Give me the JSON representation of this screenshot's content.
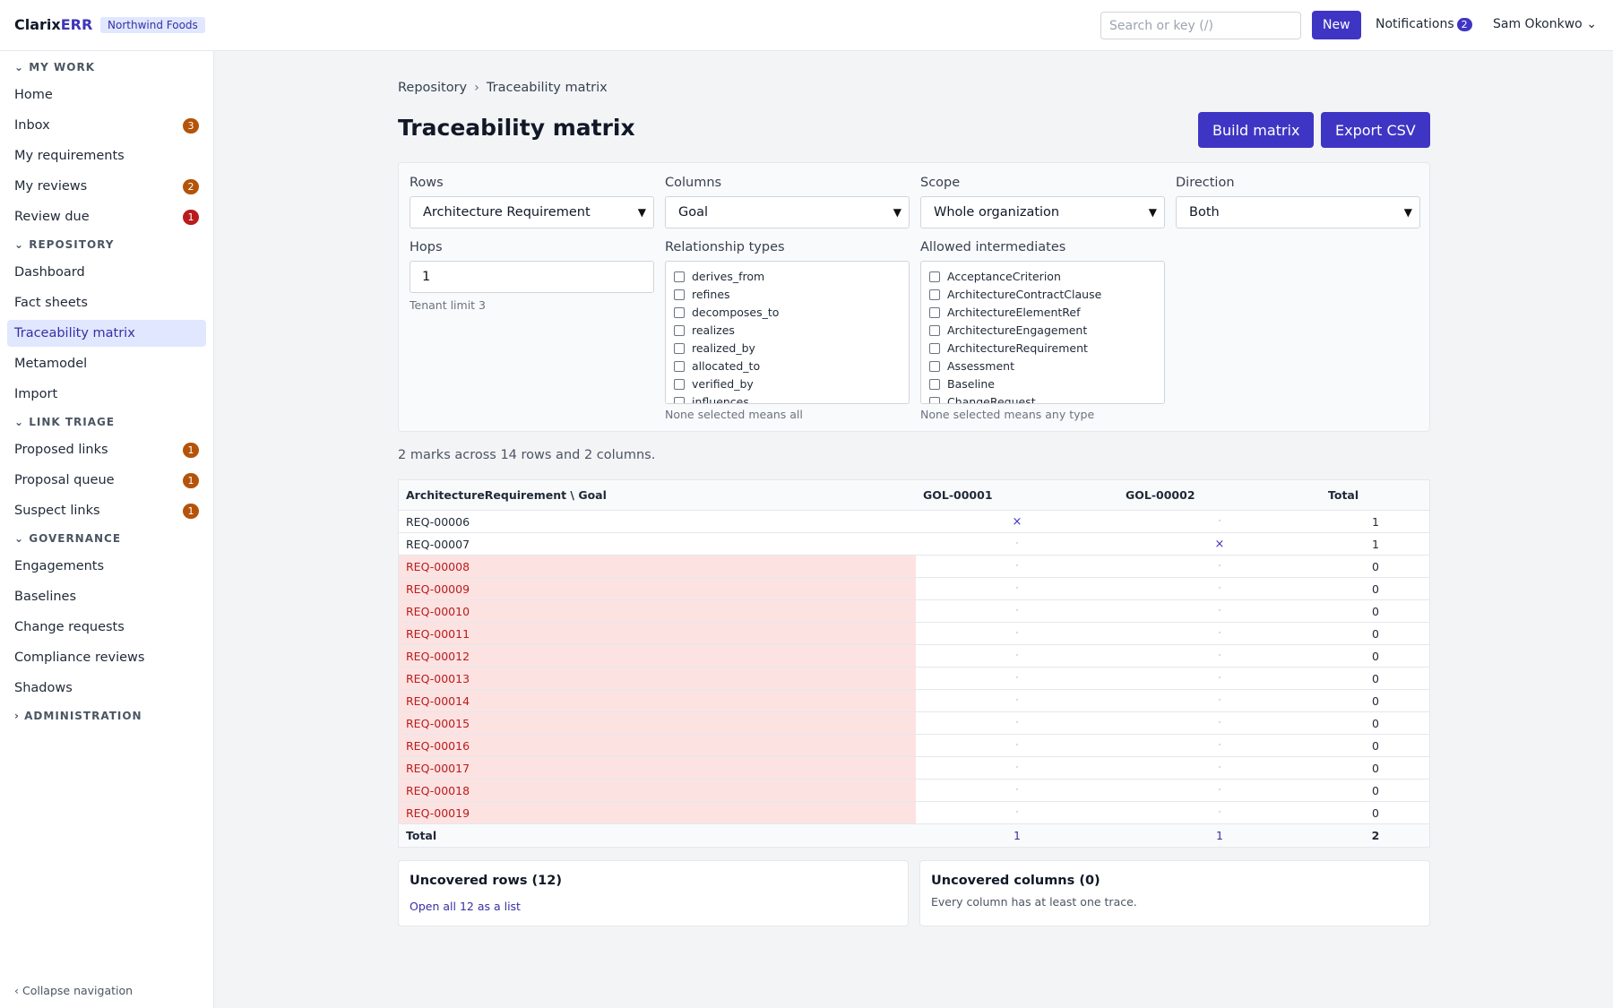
{
  "app": {
    "brand_a": "Clarix",
    "brand_b": "ERR",
    "tenant": "Northwind Foods"
  },
  "header": {
    "search_placeholder": "Search or key (/)",
    "new_label": "New",
    "notifications_label": "Notifications",
    "notifications_count": "2",
    "user": "Sam Okonkwo ⌄"
  },
  "sidebar": {
    "my_work": "⌄ MY WORK",
    "home": "Home",
    "inbox": "Inbox",
    "inbox_count": "3",
    "my_requirements": "My requirements",
    "my_reviews": "My reviews",
    "my_reviews_count": "2",
    "review_due": "Review due",
    "review_due_count": "1",
    "repository": "⌄ REPOSITORY",
    "dashboard": "Dashboard",
    "fact_sheets": "Fact sheets",
    "traceability": "Traceability matrix",
    "metamodel": "Metamodel",
    "import": "Import",
    "link_triage": "⌄ LINK TRIAGE",
    "proposed_links": "Proposed links",
    "proposed_links_count": "1",
    "proposal_queue": "Proposal queue",
    "proposal_queue_count": "1",
    "suspect_links": "Suspect links",
    "suspect_links_count": "1",
    "governance": "⌄ GOVERNANCE",
    "engagements": "Engagements",
    "baselines": "Baselines",
    "change_requests": "Change requests",
    "compliance_reviews": "Compliance reviews",
    "shadows": "Shadows",
    "administration": "› ADMINISTRATION",
    "collapse": "‹ Collapse navigation"
  },
  "breadcrumb": {
    "root": "Repository",
    "sep": "›",
    "current": "Traceability matrix"
  },
  "page": {
    "title": "Traceability matrix",
    "build_label": "Build matrix",
    "export_label": "Export CSV"
  },
  "form": {
    "rows_label": "Rows",
    "rows_value": "Architecture Requirement",
    "columns_label": "Columns",
    "columns_value": "Goal",
    "scope_label": "Scope",
    "scope_value": "Whole organization",
    "direction_label": "Direction",
    "direction_value": "Both",
    "hops_label": "Hops",
    "hops_value": "1",
    "hops_hint": "Tenant limit 3",
    "rel_label": "Relationship types",
    "rel_hint": "None selected means all",
    "relationship_types": [
      "derives_from",
      "refines",
      "decomposes_to",
      "realizes",
      "realized_by",
      "allocated_to",
      "verified_by",
      "influences"
    ],
    "inter_label": "Allowed intermediates",
    "inter_hint": "None selected means any type",
    "intermediates": [
      "AcceptanceCriterion",
      "ArchitectureContractClause",
      "ArchitectureElementRef",
      "ArchitectureEngagement",
      "ArchitectureRequirement",
      "Assessment",
      "Baseline",
      "ChangeRequest"
    ]
  },
  "summary": "2 marks across 14 rows and 2 columns.",
  "matrix": {
    "corner": "ArchitectureRequirement \\ Goal",
    "columns": [
      "GOL-00001",
      "GOL-00002"
    ],
    "total_label": "Total",
    "mark_symbol": "×",
    "empty_symbol": "·",
    "rows": [
      {
        "id": "REQ-00006",
        "marks": [
          true,
          false
        ],
        "total": "1",
        "uncovered": false
      },
      {
        "id": "REQ-00007",
        "marks": [
          false,
          true
        ],
        "total": "1",
        "uncovered": false
      },
      {
        "id": "REQ-00008",
        "marks": [
          false,
          false
        ],
        "total": "0",
        "uncovered": true
      },
      {
        "id": "REQ-00009",
        "marks": [
          false,
          false
        ],
        "total": "0",
        "uncovered": true
      },
      {
        "id": "REQ-00010",
        "marks": [
          false,
          false
        ],
        "total": "0",
        "uncovered": true
      },
      {
        "id": "REQ-00011",
        "marks": [
          false,
          false
        ],
        "total": "0",
        "uncovered": true
      },
      {
        "id": "REQ-00012",
        "marks": [
          false,
          false
        ],
        "total": "0",
        "uncovered": true
      },
      {
        "id": "REQ-00013",
        "marks": [
          false,
          false
        ],
        "total": "0",
        "uncovered": true
      },
      {
        "id": "REQ-00014",
        "marks": [
          false,
          false
        ],
        "total": "0",
        "uncovered": true
      },
      {
        "id": "REQ-00015",
        "marks": [
          false,
          false
        ],
        "total": "0",
        "uncovered": true
      },
      {
        "id": "REQ-00016",
        "marks": [
          false,
          false
        ],
        "total": "0",
        "uncovered": true
      },
      {
        "id": "REQ-00017",
        "marks": [
          false,
          false
        ],
        "total": "0",
        "uncovered": true
      },
      {
        "id": "REQ-00018",
        "marks": [
          false,
          false
        ],
        "total": "0",
        "uncovered": true
      },
      {
        "id": "REQ-00019",
        "marks": [
          false,
          false
        ],
        "total": "0",
        "uncovered": true
      }
    ],
    "col_totals": [
      "1",
      "1"
    ],
    "grand_total": "2"
  },
  "uncovered_rows": {
    "title": "Uncovered rows (12)",
    "link": "Open all 12 as a list"
  },
  "uncovered_cols": {
    "title": "Uncovered columns (0)",
    "text": "Every column has at least one trace."
  }
}
